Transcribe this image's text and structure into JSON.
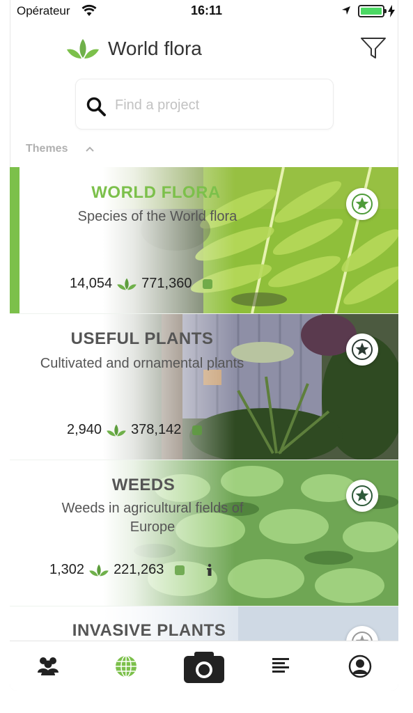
{
  "status_bar": {
    "carrier": "Opérateur",
    "time": "16:11",
    "battery_level": 1.0
  },
  "header": {
    "app_title": "World flora",
    "icons": [
      "leaf-logo-icon",
      "filter-icon"
    ]
  },
  "search": {
    "placeholder": "Find a project",
    "value": ""
  },
  "themes_section": {
    "label": "Themes",
    "expanded": true
  },
  "projects": [
    {
      "name": "WORLD FLORA",
      "description": "Species of the World flora",
      "species_count": "14,054",
      "image_count": "771,360",
      "selected": true,
      "starred": true,
      "name_color": "#7cc04b"
    },
    {
      "name": "USEFUL PLANTS",
      "description": "Cultivated and ornamental plants",
      "species_count": "2,940",
      "image_count": "378,142",
      "selected": false,
      "starred": false
    },
    {
      "name": "WEEDS",
      "description_line1": "Weeds in agricultural fields of",
      "description_line2": "Europe",
      "species_count": "1,302",
      "image_count": "221,263",
      "info_icon": true,
      "selected": false,
      "starred": false
    },
    {
      "name": "INVASIVE PLANTS",
      "selected": false,
      "starred": false
    }
  ],
  "tabbar": {
    "tabs": [
      "community-icon",
      "globe-icon",
      "camera-icon",
      "list-icon",
      "profile-icon"
    ],
    "active": "globe-icon"
  },
  "colors": {
    "accent_green": "#7cc04b",
    "star_green": "#4e9b3a",
    "star_dark": "#2b3a33"
  }
}
